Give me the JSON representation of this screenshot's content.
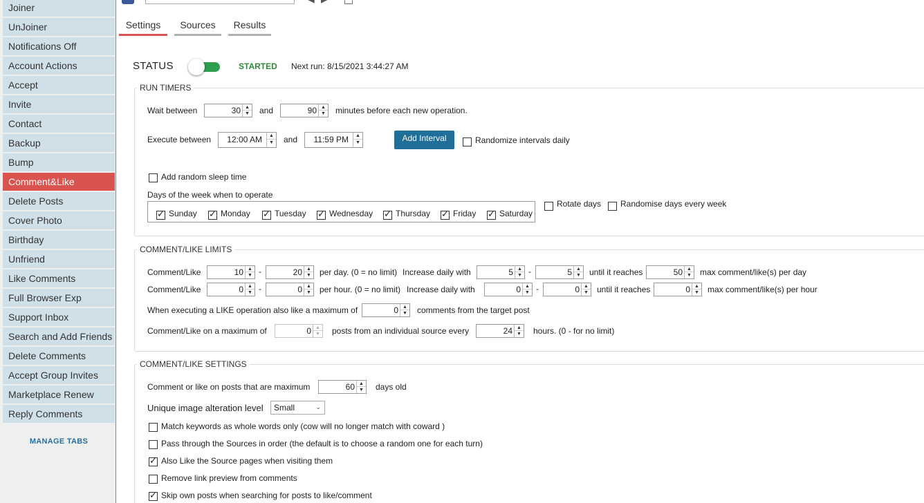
{
  "sidebar": {
    "items": [
      {
        "label": "Joiner"
      },
      {
        "label": "UnJoiner"
      },
      {
        "label": "Notifications Off"
      },
      {
        "label": "Account Actions"
      },
      {
        "label": "Accept"
      },
      {
        "label": "Invite"
      },
      {
        "label": "Contact"
      },
      {
        "label": "Backup"
      },
      {
        "label": "Bump"
      },
      {
        "label": "Comment&Like"
      },
      {
        "label": "Delete Posts"
      },
      {
        "label": "Cover Photo"
      },
      {
        "label": "Birthday"
      },
      {
        "label": "Unfriend"
      },
      {
        "label": "Like Comments"
      },
      {
        "label": "Full Browser Exp"
      },
      {
        "label": "Support Inbox"
      },
      {
        "label": "Search and Add Friends"
      },
      {
        "label": "Delete Comments"
      },
      {
        "label": "Accept Group Invites"
      },
      {
        "label": "Marketplace Renew"
      },
      {
        "label": "Reply Comments"
      }
    ],
    "active": "Comment&Like",
    "manage_tabs": "MANAGE TABS"
  },
  "tabs": [
    {
      "label": "Settings"
    },
    {
      "label": "Sources"
    },
    {
      "label": "Results"
    }
  ],
  "status": {
    "label": "STATUS",
    "state": "STARTED",
    "toggle_on": true,
    "next_run": "Next run: 8/15/2021 3:44:27 AM"
  },
  "run_timers": {
    "title": "RUN TIMERS",
    "wait_between_label": "Wait between",
    "wait_min": "30",
    "and_label": "and",
    "wait_max": "90",
    "minutes_label": "minutes before each new operation.",
    "execute_between_label": "Execute between",
    "exec_start": "12:00 AM",
    "exec_end": "11:59 PM",
    "add_interval": "Add Interval",
    "randomize_intervals": "Randomize intervals daily",
    "add_random_sleep": "Add random sleep time",
    "days_label": "Days of the week when to operate",
    "days": [
      "Sunday",
      "Monday",
      "Tuesday",
      "Wednesday",
      "Thursday",
      "Friday",
      "Saturday"
    ],
    "rotate_days": "Rotate days",
    "randomise_days": "Randomise days every week"
  },
  "limits": {
    "title": "COMMENT/LIKE LIMITS",
    "row1_label": "Comment/Like",
    "row1_min": "10",
    "row1_max": "20",
    "per_day": "per day. (0 = no limit)",
    "increase_daily": "Increase daily with",
    "row1_inc_min": "5",
    "row1_inc_max": "5",
    "until_reaches": "until it reaches",
    "row1_cap": "50",
    "max_per_day": "max comment/like(s) per day",
    "row2_label": "Comment/Like",
    "row2_min": "0",
    "row2_max": "0",
    "per_hour": "per hour. (0 = no limit)",
    "row2_inc_min": "0",
    "row2_inc_max": "0",
    "row2_cap": "0",
    "max_per_hour": "max comment/like(s) per hour",
    "like_op_label": "When executing a LIKE operation also like a maximum of",
    "like_op_value": "0",
    "like_op_suffix": "comments from the target post",
    "max_posts_label": "Comment/Like on a maximum of",
    "max_posts_value": "0",
    "posts_from_source": "posts from an individual source every",
    "hours_value": "24",
    "hours_suffix": "hours. (0 - for no limit)",
    "sep": "-"
  },
  "settings": {
    "title": "COMMENT/LIKE SETTINGS",
    "max_age_label": "Comment or like on posts that are maximum",
    "max_age_value": "60",
    "days_old": "days old",
    "image_alt_label": "Unique image alteration level",
    "image_alt_value": "Small",
    "options": [
      {
        "label": "Match keywords as whole words only (cow will no longer match with coward )",
        "checked": false
      },
      {
        "label": "Pass through the Sources in order (the default is to choose a random one for each turn)",
        "checked": false
      },
      {
        "label": "Also Like the Source pages when visiting them",
        "checked": true
      },
      {
        "label": "Remove link preview from comments",
        "checked": false
      },
      {
        "label": "Skip own posts when searching for posts to like/comment",
        "checked": true
      }
    ]
  },
  "colors": {
    "accent_red": "#d9534f",
    "sidebar_item": "#cfe0e8",
    "button_blue": "#1f6f99",
    "started_green": "#2e8b3c"
  }
}
